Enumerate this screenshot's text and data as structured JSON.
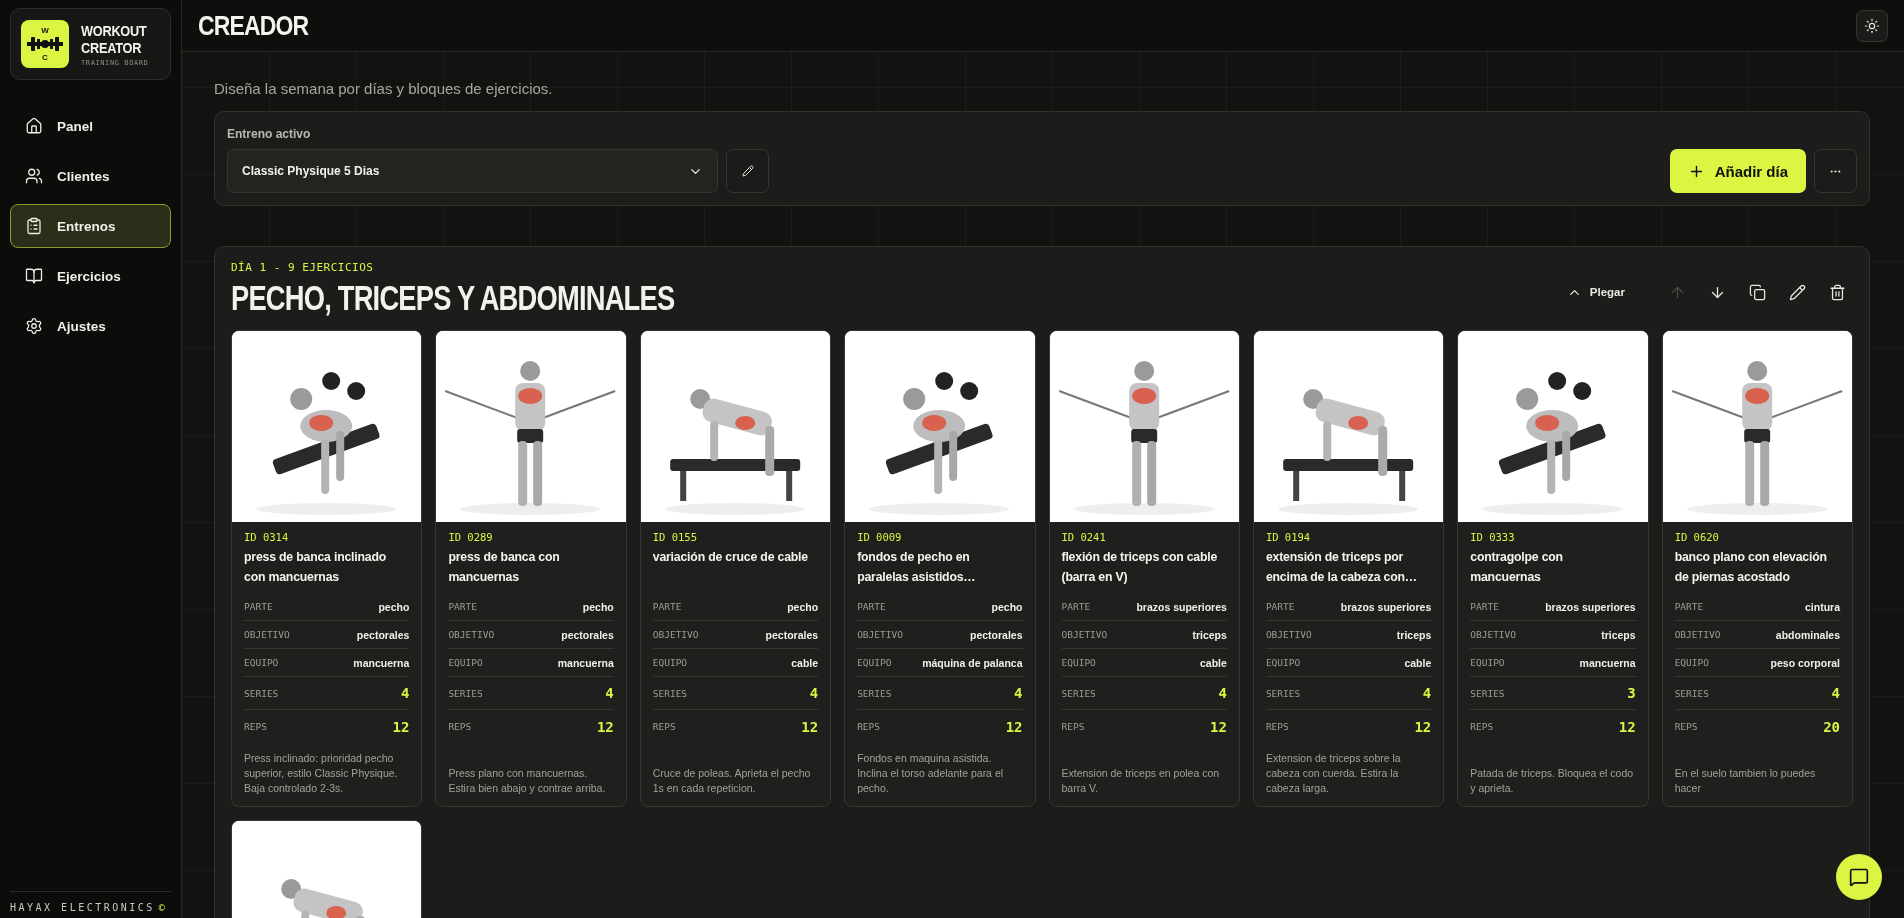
{
  "app": {
    "logo_top": "W",
    "logo_bottom": "C",
    "name_line1": "WORKOUT",
    "name_line2": "CREATOR",
    "tagline": "TRAINING BOARD"
  },
  "nav": [
    {
      "label": "Panel",
      "kind": "home",
      "selected": false
    },
    {
      "label": "Clientes",
      "kind": "users",
      "selected": false
    },
    {
      "label": "Entrenos",
      "kind": "clipboard",
      "selected": true
    },
    {
      "label": "Ejercicios",
      "kind": "book",
      "selected": false
    },
    {
      "label": "Ajustes",
      "kind": "settings",
      "selected": false
    }
  ],
  "footer": {
    "brand": "HAYAX ELECTRONICS",
    "mark": "©"
  },
  "header": {
    "title": "CREADOR"
  },
  "subtitle": "Diseña la semana por días y bloques de ejercicios.",
  "active_training": {
    "label": "Entreno activo",
    "value": "Classic Physique 5 Dias",
    "add_label": "Añadir día"
  },
  "day": {
    "tag": "DÍA 1 - 9 EJERCICIOS",
    "title": "PECHO, TRICEPS Y ABDOMINALES",
    "collapse_label": "Plegar",
    "actions": [
      {
        "kind": "up",
        "disabled": true
      },
      {
        "kind": "down",
        "disabled": false
      },
      {
        "kind": "copy",
        "disabled": false
      },
      {
        "kind": "edit",
        "disabled": false
      },
      {
        "kind": "delete",
        "disabled": false
      }
    ],
    "exercises": [
      {
        "kind": "card",
        "id": "ID 0314",
        "name": "press de banca inclinado con mancuernas",
        "fields": [
          {
            "kind": "text",
            "label": "PARTE",
            "value": "pecho"
          },
          {
            "kind": "text",
            "label": "OBJETIVO",
            "value": "pectorales"
          },
          {
            "kind": "text",
            "label": "EQUIPO",
            "value": "mancuerna"
          },
          {
            "kind": "number",
            "label": "SERIES",
            "value": "4"
          },
          {
            "kind": "number",
            "label": "REPS",
            "value": "12"
          }
        ],
        "note": "Press inclinado: prioridad pecho superior, estilo Classic Physique. Baja controlado 2-3s."
      },
      {
        "kind": "card",
        "id": "ID 0289",
        "name": "press de banca con mancuernas",
        "fields": [
          {
            "kind": "text",
            "label": "PARTE",
            "value": "pecho"
          },
          {
            "kind": "text",
            "label": "OBJETIVO",
            "value": "pectorales"
          },
          {
            "kind": "text",
            "label": "EQUIPO",
            "value": "mancuerna"
          },
          {
            "kind": "number",
            "label": "SERIES",
            "value": "4"
          },
          {
            "kind": "number",
            "label": "REPS",
            "value": "12"
          }
        ],
        "note": "Press plano con mancuernas. Estira bien abajo y contrae arriba."
      },
      {
        "kind": "card",
        "id": "ID 0155",
        "name": "variación de cruce de cable",
        "fields": [
          {
            "kind": "text",
            "label": "PARTE",
            "value": "pecho"
          },
          {
            "kind": "text",
            "label": "OBJETIVO",
            "value": "pectorales"
          },
          {
            "kind": "text",
            "label": "EQUIPO",
            "value": "cable"
          },
          {
            "kind": "number",
            "label": "SERIES",
            "value": "4"
          },
          {
            "kind": "number",
            "label": "REPS",
            "value": "12"
          }
        ],
        "note": "Cruce de poleas. Aprieta el pecho 1s en cada repeticion."
      },
      {
        "kind": "card",
        "id": "ID 0009",
        "name": "fondos de pecho en paralelas asistidos…",
        "fields": [
          {
            "kind": "text",
            "label": "PARTE",
            "value": "pecho"
          },
          {
            "kind": "text",
            "label": "OBJETIVO",
            "value": "pectorales"
          },
          {
            "kind": "text",
            "label": "EQUIPO",
            "value": "máquina de palanca"
          },
          {
            "kind": "number",
            "label": "SERIES",
            "value": "4"
          },
          {
            "kind": "number",
            "label": "REPS",
            "value": "12"
          }
        ],
        "note": "Fondos en maquina asistida. Inclina el torso adelante para el pecho."
      },
      {
        "kind": "card",
        "id": "ID 0241",
        "name": "flexión de triceps con cable (barra en V)",
        "fields": [
          {
            "kind": "text",
            "label": "PARTE",
            "value": "brazos superiores"
          },
          {
            "kind": "text",
            "label": "OBJETIVO",
            "value": "triceps"
          },
          {
            "kind": "text",
            "label": "EQUIPO",
            "value": "cable"
          },
          {
            "kind": "number",
            "label": "SERIES",
            "value": "4"
          },
          {
            "kind": "number",
            "label": "REPS",
            "value": "12"
          }
        ],
        "note": "Extension de triceps en polea con barra V."
      },
      {
        "kind": "card",
        "id": "ID 0194",
        "name": "extensión de triceps por encima de la cabeza con…",
        "fields": [
          {
            "kind": "text",
            "label": "PARTE",
            "value": "brazos superiores"
          },
          {
            "kind": "text",
            "label": "OBJETIVO",
            "value": "triceps"
          },
          {
            "kind": "text",
            "label": "EQUIPO",
            "value": "cable"
          },
          {
            "kind": "number",
            "label": "SERIES",
            "value": "4"
          },
          {
            "kind": "number",
            "label": "REPS",
            "value": "12"
          }
        ],
        "note": "Extension de triceps sobre la cabeza con cuerda. Estira la cabeza larga."
      },
      {
        "kind": "card",
        "id": "ID 0333",
        "name": "contragolpe con mancuernas",
        "fields": [
          {
            "kind": "text",
            "label": "PARTE",
            "value": "brazos superiores"
          },
          {
            "kind": "text",
            "label": "OBJETIVO",
            "value": "triceps"
          },
          {
            "kind": "text",
            "label": "EQUIPO",
            "value": "mancuerna"
          },
          {
            "kind": "number",
            "label": "SERIES",
            "value": "3"
          },
          {
            "kind": "number",
            "label": "REPS",
            "value": "12"
          }
        ],
        "note": "Patada de triceps. Bloquea el codo y aprieta."
      },
      {
        "kind": "card",
        "id": "ID 0620",
        "name": "banco plano con elevación de piernas acostado",
        "fields": [
          {
            "kind": "text",
            "label": "PARTE",
            "value": "cintura"
          },
          {
            "kind": "text",
            "label": "OBJETIVO",
            "value": "abdominales"
          },
          {
            "kind": "text",
            "label": "EQUIPO",
            "value": "peso corporal"
          },
          {
            "kind": "number",
            "label": "SERIES",
            "value": "4"
          },
          {
            "kind": "number",
            "label": "REPS",
            "value": "20"
          }
        ],
        "note": "En el suelo tambien lo puedes hacer"
      },
      {
        "kind": "picture"
      }
    ]
  }
}
